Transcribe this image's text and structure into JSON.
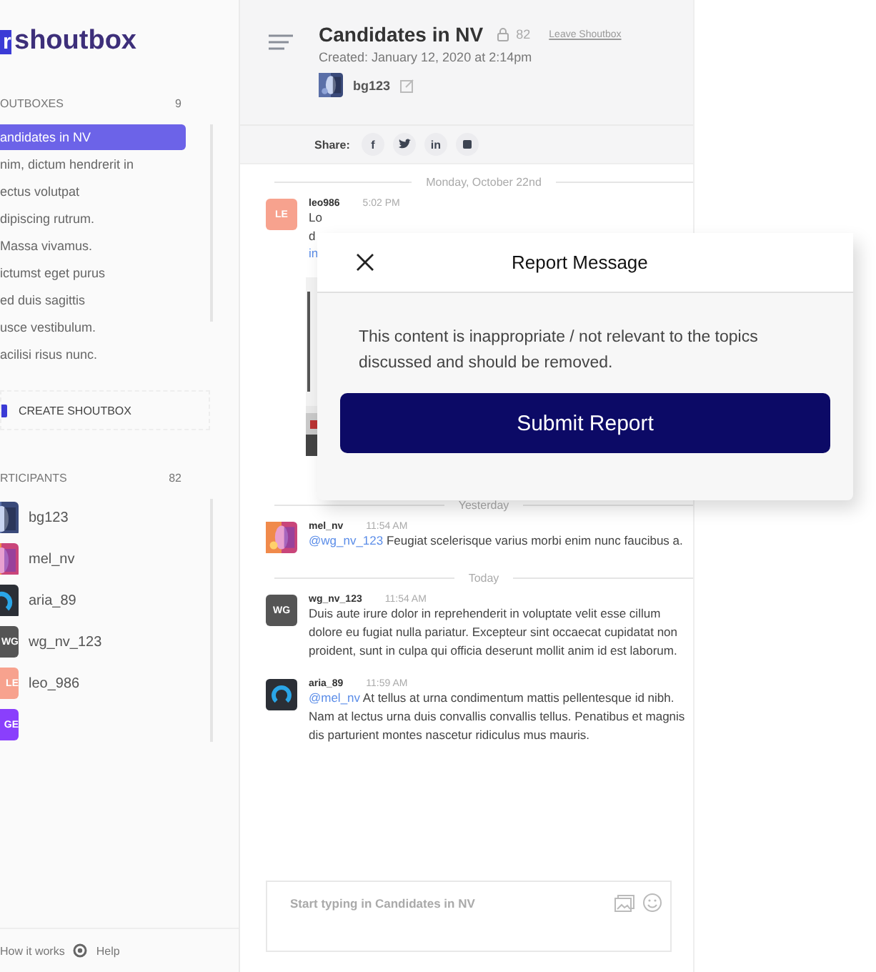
{
  "logo": {
    "mark": "r",
    "name": "shoutbox"
  },
  "shoutboxes": {
    "title": "OUTBOXES",
    "count": "9",
    "items": [
      {
        "label": "andidates in NV",
        "selected": true
      },
      {
        "label": "nim, dictum hendrerit in",
        "selected": false
      },
      {
        "label": "ectus volutpat",
        "selected": false
      },
      {
        "label": "dipiscing rutrum.",
        "selected": false
      },
      {
        "label": "Massa vivamus.",
        "selected": false
      },
      {
        "label": "ictumst eget purus",
        "selected": false
      },
      {
        "label": "ed duis sagittis",
        "selected": false
      },
      {
        "label": "usce vestibulum.",
        "selected": false
      },
      {
        "label": "acilisi risus nunc.",
        "selected": false
      }
    ],
    "create": "CREATE SHOUTBOX"
  },
  "participants": {
    "title": "RTICIPANTS",
    "count": "82",
    "items": [
      {
        "name": "bg123",
        "kind": "picture"
      },
      {
        "name": "mel_nv",
        "kind": "picture"
      },
      {
        "name": "aria_89",
        "kind": "logo"
      },
      {
        "name": "wg_nv_123",
        "kind": "initials",
        "initials": "WG",
        "color": "#555555"
      },
      {
        "name": "leo_986",
        "kind": "initials",
        "initials": "LE",
        "color": "#f7a28e"
      },
      {
        "kind": "initials",
        "initials": "GE",
        "color": "#8a3ffc"
      }
    ]
  },
  "footer": {
    "how": "How it works",
    "help": "Help"
  },
  "header": {
    "title": "Candidates in NV",
    "members": "82",
    "leave": "Leave Shoutbox",
    "created": "Created: January 12, 2020 at 2:14pm",
    "owner": "bg123",
    "share_label": "Share:",
    "share": [
      {
        "kind": "text",
        "label": "f"
      },
      {
        "kind": "twitter"
      },
      {
        "kind": "text",
        "label": "in"
      },
      {
        "kind": "square"
      }
    ]
  },
  "feed": [
    {
      "kind": "divider",
      "label": "Monday, October 22nd"
    },
    {
      "kind": "message",
      "user": "leo986",
      "avatar": {
        "kind": "initials",
        "initials": "LE",
        "color": "#f7a28e"
      },
      "time": "5:02 PM",
      "lines": [
        "Lo",
        "d"
      ],
      "link": "in",
      "attachment": true
    },
    {
      "kind": "divider",
      "label": "Yesterday"
    },
    {
      "kind": "message",
      "user": "mel_nv",
      "time": "11:54 AM",
      "text": "@wg_nv_123",
      "body": " Feugiat scelerisque varius morbi enim nunc faucibus a."
    },
    {
      "kind": "divider",
      "label": "Today"
    },
    {
      "kind": "message",
      "user": "wg_nv_123",
      "avatar": {
        "kind": "initials",
        "initials": "WG",
        "color": "#555555"
      },
      "time": "11:54 AM",
      "body": "Duis aute irure dolor in reprehenderit in voluptate velit esse cillum dolore eu fugiat nulla pariatur. Excepteur sint occaecat cupidatat non proident, sunt in culpa qui officia deserunt mollit anim id est laborum."
    },
    {
      "kind": "message",
      "user": "aria_89",
      "avatar": {
        "kind": "logo"
      },
      "time": "11:59 AM",
      "text": "@mel_nv",
      "body": " At tellus at urna condimentum mattis pellentesque id nibh. Nam at lectus urna duis convallis convallis tellus. Penatibus et magnis dis parturient montes nascetur ridiculus mus mauris."
    }
  ],
  "composer": {
    "placeholder": "Start typing in Candidates in NV"
  },
  "modal": {
    "title": "Report Message",
    "text": "This content is inappropriate / not relevant to the topics discussed and should be removed.",
    "button": "Submit Report"
  }
}
